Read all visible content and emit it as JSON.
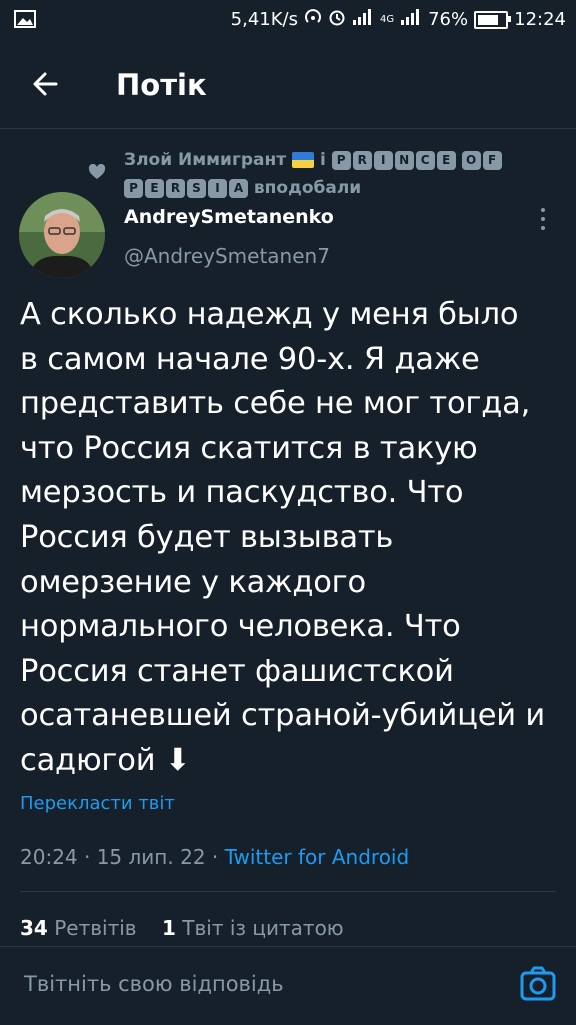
{
  "status_bar": {
    "speed": "5,41K/s",
    "network": "4G",
    "battery": "76%",
    "battery_level": 0.76,
    "time": "12:24"
  },
  "header": {
    "title": "Потік"
  },
  "liked_by": {
    "user1": "Злой Иммигрант",
    "conjunction": "і",
    "user2_line1": [
      "P",
      "R",
      "I",
      "N",
      "C",
      "E"
    ],
    "user2_of": [
      "O",
      "F"
    ],
    "user2_line2": [
      "P",
      "E",
      "R",
      "S",
      "I",
      "A"
    ],
    "suffix": "вподобали"
  },
  "author": {
    "name": "AndreySmetanenko",
    "handle": "@AndreySmetanen7"
  },
  "tweet": {
    "lines": [
      "А сколько надежд у меня было",
      "в самом начале 90-х. Я даже",
      "представить себе не мог тогда,",
      "что Россия скатится в такую",
      "мерзость и паскудство. Что",
      "Россия будет вызывать",
      "омерзение у каждого",
      "нормального человека. Что",
      "Россия станет фашистской",
      "осатаневшей страной-убийцей и",
      "садюгой ⬇"
    ],
    "translate_label": "Перекласти твіт",
    "time_date": "20:24 · 15 лип. 22 · ",
    "source": "Twitter for Android"
  },
  "stats": {
    "retweets_count": "34",
    "retweets_label": "Ретвітів",
    "quotes_count": "1",
    "quotes_label": "Твіт із цитатою"
  },
  "reply": {
    "placeholder": "Твітніть свою відповідь"
  },
  "colors": {
    "background": "#15202b",
    "accent": "#1d9bf0",
    "muted": "#8899a6"
  }
}
